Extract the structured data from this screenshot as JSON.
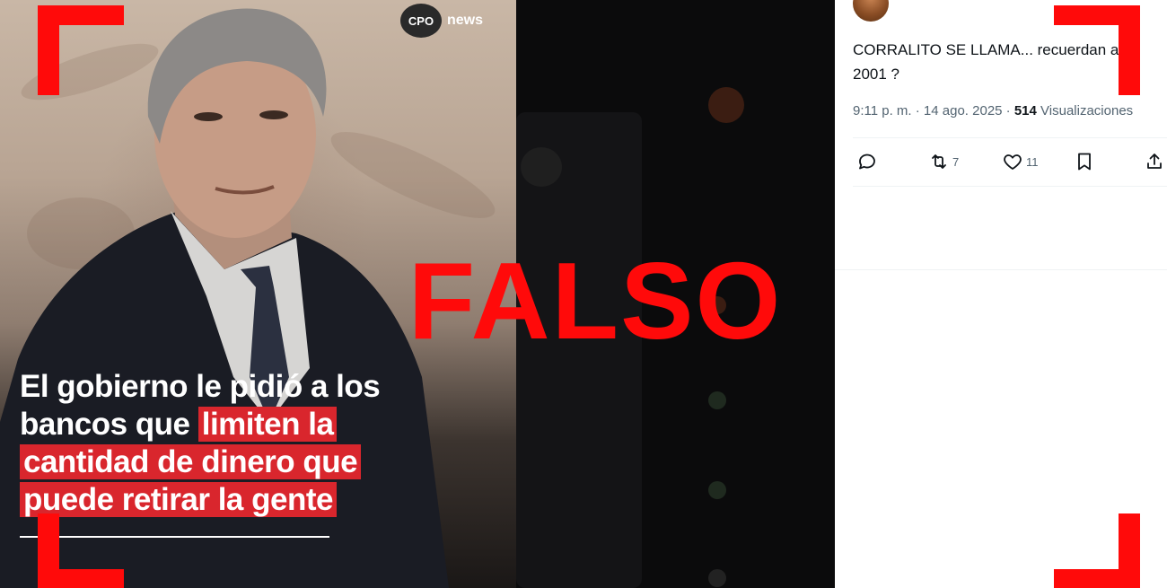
{
  "news_card": {
    "brand_logo": "CPO",
    "brand_word": "news",
    "headline": {
      "line1": "El gobierno le pidió a los",
      "line2_plain": "bancos que ",
      "line2_highlight": "limiten la",
      "line3_highlight": "cantidad de dinero que",
      "line4_highlight": "puede retirar la gente"
    },
    "highlight_color": "#d9262d"
  },
  "stamp": {
    "label": "FALSO",
    "color": "#ff0a0a"
  },
  "tweet": {
    "text": "CORRALITO SE LLAMA... recuerdan año 2001 ?",
    "meta_time": "9:11 p. m. · 14 ago. 2025 · ",
    "views_count": "514",
    "views_label": " Visualizaciones",
    "actions": {
      "reply_icon": "reply-icon",
      "retweet_icon": "retweet-icon",
      "retweet_count": "7",
      "like_icon": "heart-icon",
      "like_count": "11",
      "bookmark_icon": "bookmark-icon",
      "share_icon": "share-icon"
    }
  },
  "colors": {
    "corner_marks": "#ff0a0a"
  }
}
